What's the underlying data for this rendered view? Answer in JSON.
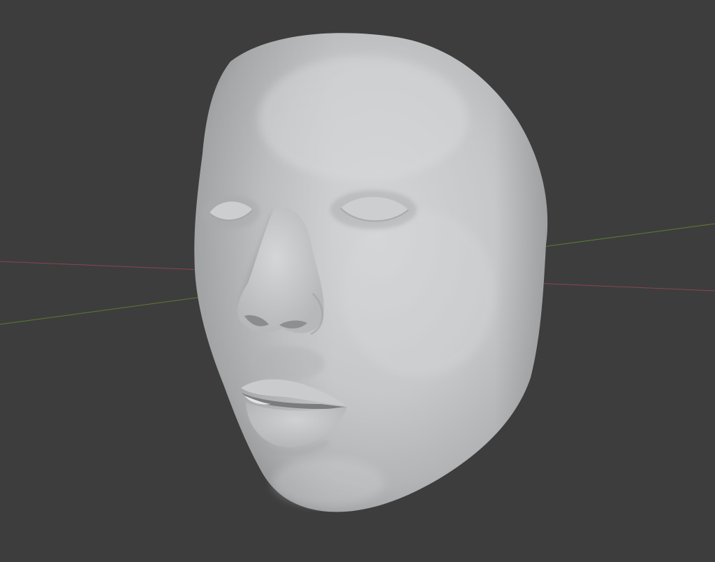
{
  "viewport": {
    "background_color": "#3d3d3d",
    "x_axis_color": "#8a4550",
    "y_axis_color": "#5e7a32",
    "mesh_base_color": "#c4c6c8",
    "mesh_shadow_color": "#9a9c9e",
    "mesh_highlight_color": "#d6d8d9"
  },
  "scene": {
    "object": "face-mesh",
    "shading": "solid"
  }
}
